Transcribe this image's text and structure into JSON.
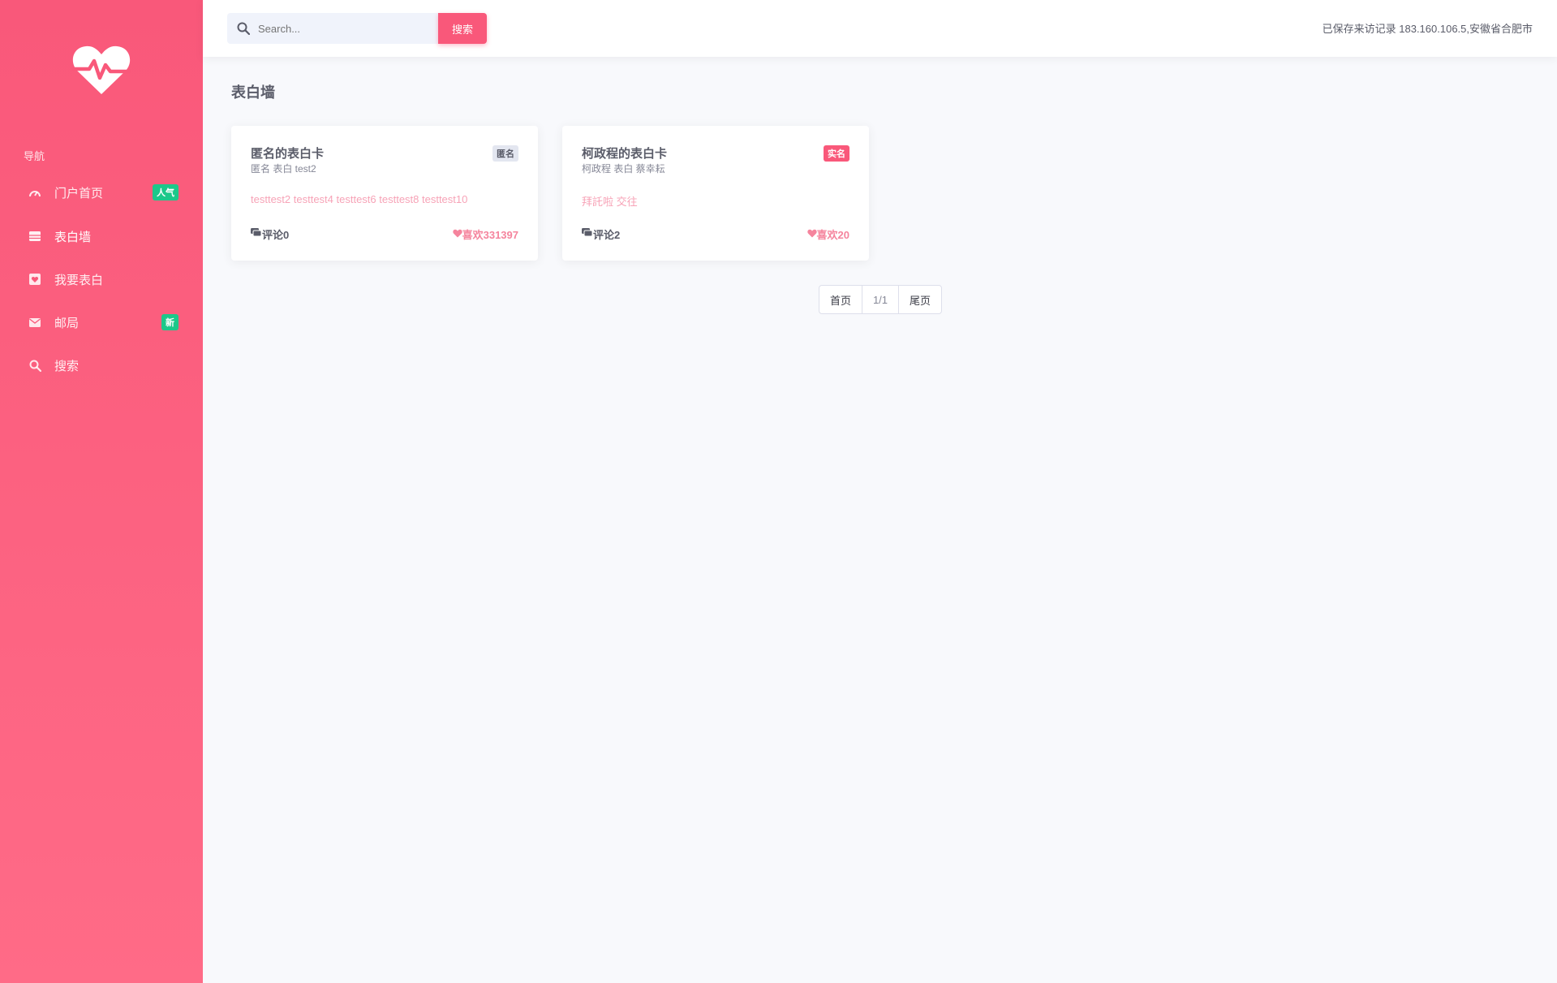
{
  "colors": {
    "brand": "#f9587a",
    "badge_green": "#1cc88a",
    "content_bg": "#f8f9fc"
  },
  "sidebar": {
    "logo_icon": "heart-pulse-icon",
    "heading": "导航",
    "items": [
      {
        "label": "门户首页",
        "icon": "dashboard-icon",
        "badge": "人气"
      },
      {
        "label": "表白墙",
        "icon": "table-icon",
        "badge": ""
      },
      {
        "label": "我要表白",
        "icon": "heart-box-icon",
        "badge": ""
      },
      {
        "label": "邮局",
        "icon": "envelope-icon",
        "badge": "新"
      },
      {
        "label": "搜索",
        "icon": "search-doc-icon",
        "badge": ""
      }
    ]
  },
  "topbar": {
    "search_placeholder": "Search...",
    "search_button": "搜索",
    "visit_info": "已保存来访记录 183.160.106.5,安徽省合肥市"
  },
  "main": {
    "title": "表白墙",
    "cards": [
      {
        "title": "匿名的表白卡",
        "subtitle": "匿名 表白 test2",
        "badge": "匿名",
        "tags": "testtest2 testtest4 testtest6 testtest8 testtest10",
        "comments": "评论0",
        "likes": "喜欢331397"
      },
      {
        "title": "柯政程的表白卡",
        "subtitle": "柯政程 表白 蔡幸耘",
        "badge": "实名",
        "tags": "拜託啦 交往",
        "comments": "评论2",
        "likes": "喜欢20"
      }
    ],
    "pagination": {
      "first": "首页",
      "current": "1/1",
      "last": "尾页"
    }
  }
}
